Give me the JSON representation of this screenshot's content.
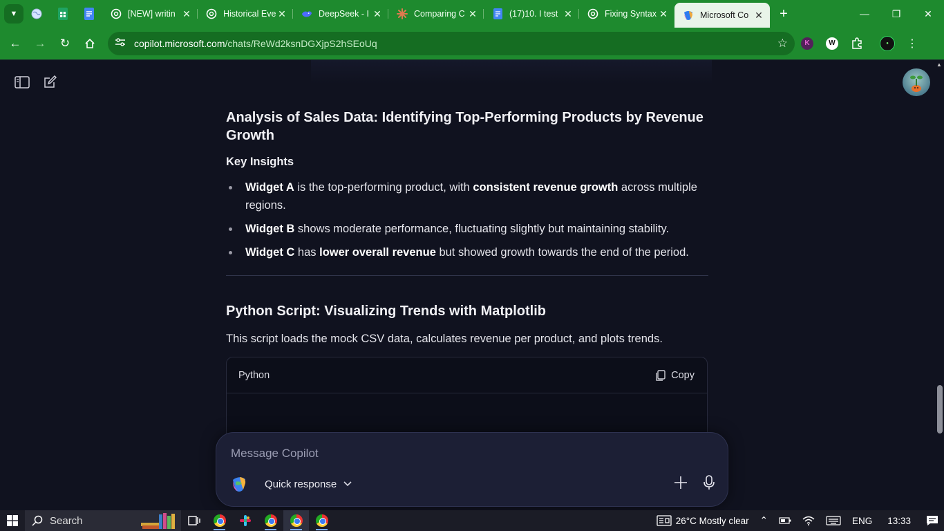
{
  "tabs": [
    {
      "title": "[NEW] writin",
      "icon": "openai-icon"
    },
    {
      "title": "Historical Eve",
      "icon": "openai-icon"
    },
    {
      "title": "DeepSeek - I",
      "icon": "deepseek-icon"
    },
    {
      "title": "Comparing C",
      "icon": "claude-icon"
    },
    {
      "title": "(17)10. I test",
      "icon": "docs-icon"
    },
    {
      "title": "Fixing Syntax",
      "icon": "openai-icon"
    },
    {
      "title": "Microsoft Co",
      "icon": "copilot-icon",
      "active": true
    }
  ],
  "address": {
    "host": "copilot.microsoft.com",
    "path": "/chats/ReWd2ksnDGXjpS2hSEoUq"
  },
  "extensions": {
    "k_label": "K",
    "w_label": "W"
  },
  "content": {
    "heading1": "Analysis of Sales Data: Identifying Top-Performing Products by Revenue Growth",
    "subheading": "Key Insights",
    "bullets": [
      {
        "b1": "Widget A",
        "t1": " is the top-performing product, with ",
        "b2": "consistent revenue growth",
        "t2": " across multiple regions."
      },
      {
        "b1": "Widget B",
        "t1": " shows moderate performance, fluctuating slightly but maintaining stability."
      },
      {
        "b1": "Widget C",
        "t1": " has ",
        "b2": "lower overall revenue",
        "t2": " but showed growth towards the end of the period."
      }
    ],
    "heading2": "Python Script: Visualizing Trends with Matplotlib",
    "lead": "This script loads the mock CSV data, calculates revenue per product, and plots trends.",
    "code_lang": "Python",
    "copy_label": "Copy"
  },
  "composer": {
    "placeholder": "Message Copilot",
    "mode_label": "Quick response"
  },
  "taskbar": {
    "search_label": "Search",
    "weather": "26°C  Mostly clear",
    "lang": "ENG",
    "time": "13:33"
  },
  "colors": {
    "browser_frame": "#1e8a2e",
    "page_bg": "#10121f",
    "composer_bg": "#1c1f35"
  }
}
